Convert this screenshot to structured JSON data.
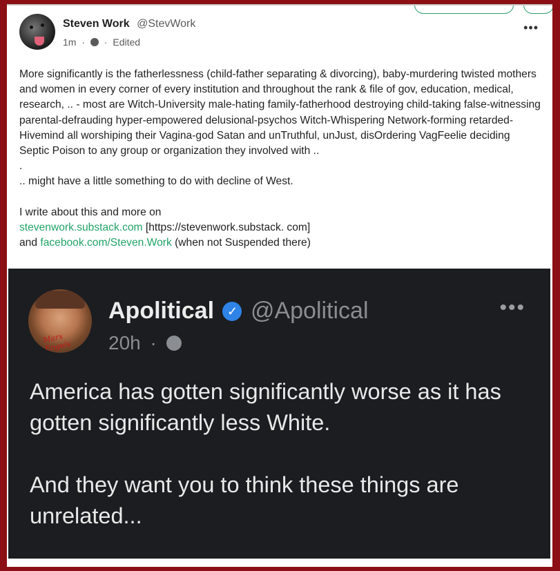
{
  "post": {
    "author_name": "Steven Work",
    "author_handle": "@StevWork",
    "time": "1m",
    "separator": "·",
    "edited": "Edited",
    "more_icon": "•••",
    "body_lines": [
      "More significantly is the fatherlessness (child-father separating & divorcing), baby-murdering twisted mothers and women in every corner of every institution and throughout the rank & file of gov, education, medical, research, .. - most are Witch-University male-hating family-fatherhood destroying child-taking false-witnessing parental-defrauding hyper-empowered delusional-psychos Witch-Whispering Network-forming retarded-Hivemind all worshiping their Vagina-god Satan and unTruthful, unJust, disOrdering VagFeelie deciding Septic Poison to any group or organization they involved with ..",
      ".",
      ".. might have a little something to do with decline of West."
    ],
    "promo_intro": "I write about this and more on",
    "link1": "stevenwork.substack.com",
    "link1_bracket": " [https://stevenwork.substack. com]",
    "and_text": "and ",
    "link2": "facebook.com/Steven.Work",
    "link2_suffix": " (when not Suspended there)"
  },
  "embedded": {
    "author_name": "Apolitical",
    "verified_icon": "✓",
    "author_handle": "@Apolitical",
    "time": "20h",
    "separator": "·",
    "more_icon": "•••",
    "avatar_signature": "Marx Engels",
    "paragraph1": "America has gotten significantly worse as it has gotten significantly less White.",
    "paragraph2": "And they want you to think these things are unrelated..."
  },
  "colors": {
    "border": "#8b0f14",
    "link": "#21a366",
    "embed_bg": "#1b1d20",
    "verified": "#2f83e6"
  }
}
